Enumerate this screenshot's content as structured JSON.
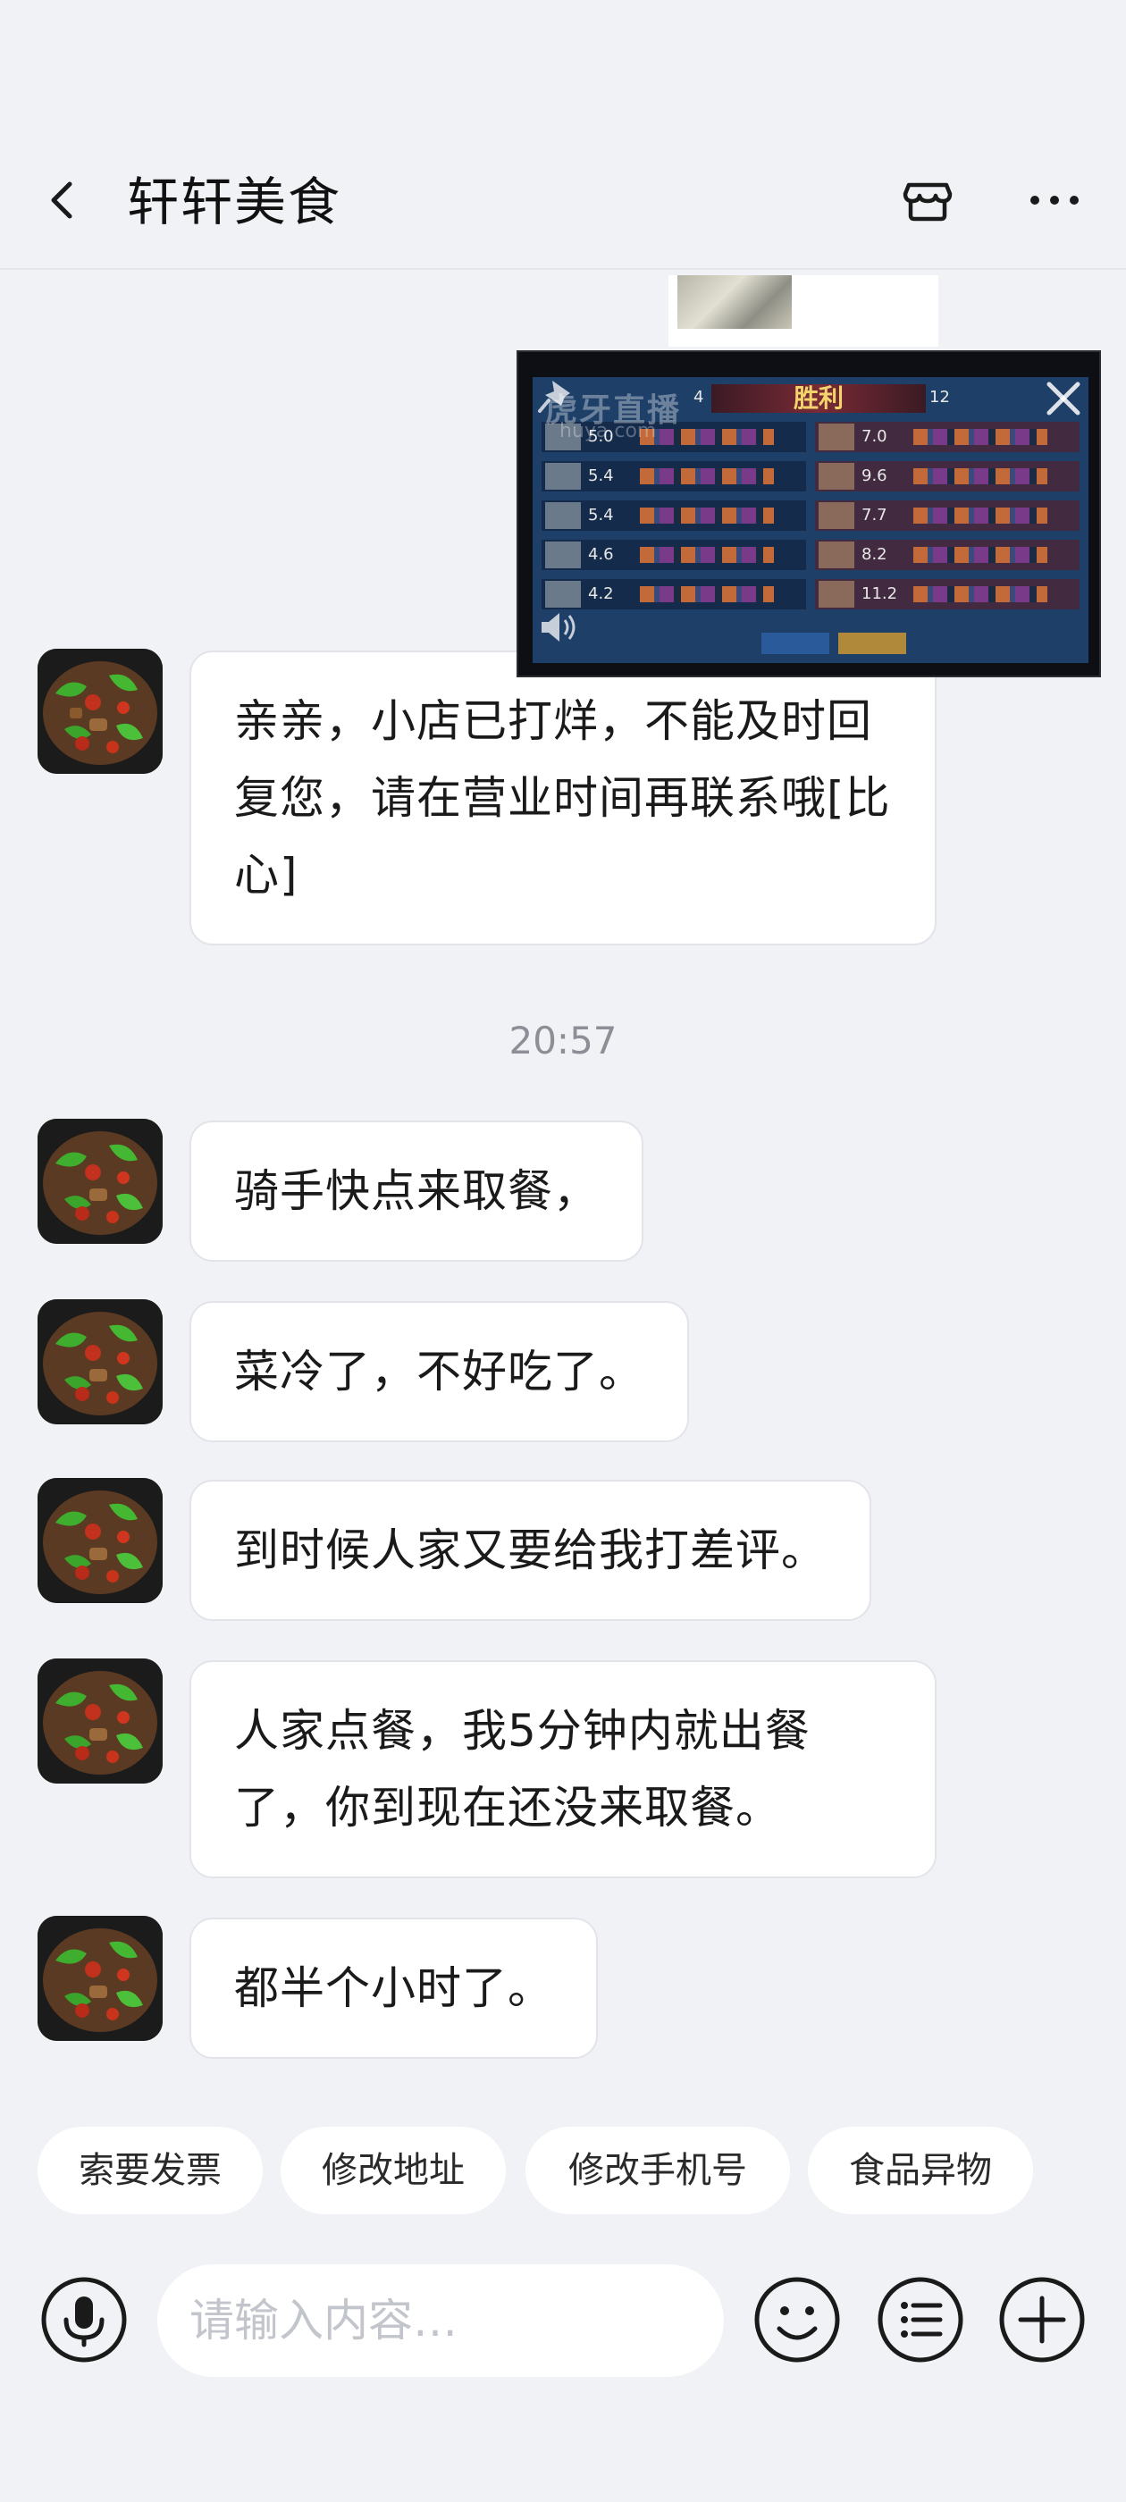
{
  "header": {
    "title": "轩轩美食"
  },
  "messages": [
    {
      "text": "亲亲，小店已打烊，不能及时回复您，请在营业时间再联系哦[比心]"
    },
    {
      "text": "骑手快点来取餐，"
    },
    {
      "text": "菜冷了，不好吃了。"
    },
    {
      "text": "到时候人家又要给我打差评。"
    },
    {
      "text": "人家点餐，我5分钟内就出餐了，你到现在还没来取餐。"
    },
    {
      "text": "都半个小时了。"
    }
  ],
  "timestamp": "20:57",
  "floating_video": {
    "result_text": "胜利",
    "score_left": "4",
    "score_right": "12",
    "watermark": "虎牙直播",
    "watermark_sub": "huya.com",
    "rows": [
      {
        "left": "5.0",
        "right": "7.0"
      },
      {
        "left": "5.4",
        "right": "9.6"
      },
      {
        "left": "5.4",
        "right": "7.7"
      },
      {
        "left": "4.6",
        "right": "8.2"
      },
      {
        "left": "4.2",
        "right": "11.2"
      }
    ]
  },
  "quick_replies": [
    "索要发票",
    "修改地址",
    "修改手机号",
    "食品异物"
  ],
  "input": {
    "placeholder": "请输入内容…"
  },
  "colors": {
    "background": "#f1f2f6",
    "bubble": "#ffffff",
    "timestamp": "#8d8f96"
  },
  "icons": [
    "back-icon",
    "store-icon",
    "more-icon",
    "voice-icon",
    "emoji-icon",
    "list-icon",
    "plus-icon"
  ]
}
